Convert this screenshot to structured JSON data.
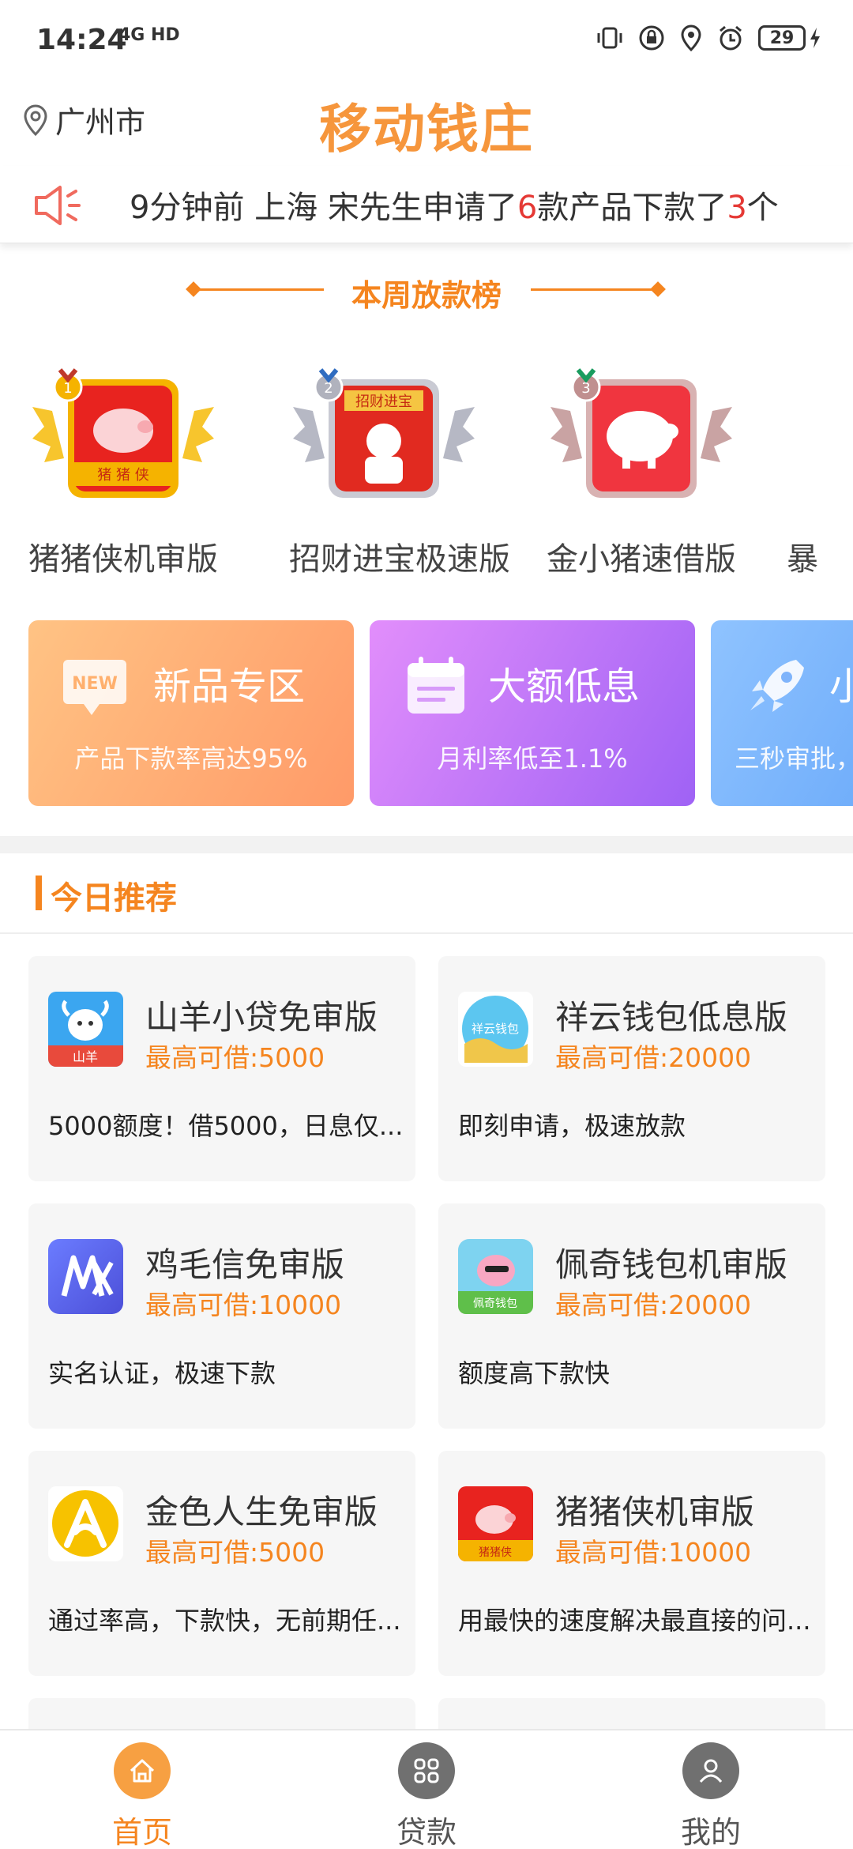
{
  "status": {
    "time": "14:24",
    "network": "4G HD",
    "battery": "29"
  },
  "header": {
    "location": "广州市",
    "title": "移动钱庄"
  },
  "notice": {
    "prefix": "9分钟前 上海 宋先生申请了",
    "apply_count": "6",
    "middle": "款产品下款了",
    "loan_count": "3",
    "suffix": "个"
  },
  "ranking": {
    "title": "本周放款榜",
    "items": [
      {
        "name": "猪猪侠机审版",
        "logo_text": "猪 猪 侠",
        "medal": "1"
      },
      {
        "name": "招财进宝极速版",
        "logo_text": "招财进宝",
        "medal": "2"
      },
      {
        "name": "金小猪速借版",
        "logo_text": "",
        "medal": "3"
      },
      {
        "name": "暴",
        "logo_text": "",
        "medal": ""
      }
    ]
  },
  "promos": [
    {
      "title": "新品专区",
      "subtitle": "产品下款率高达95%",
      "icon": "new-badge-icon",
      "badge": "NEW"
    },
    {
      "title": "大额低息",
      "subtitle": "月利率低至1.1%",
      "icon": "calendar-icon"
    },
    {
      "title": "小",
      "subtitle": "三秒审批，",
      "icon": "rocket-icon"
    }
  ],
  "today": {
    "title": "今日推荐",
    "cards": [
      {
        "name": "山羊小贷免审版",
        "amount": "最高可借:5000",
        "desc": "5000额度！借5000，日息仅...",
        "logo": "goat-logo",
        "logo_text": "山羊"
      },
      {
        "name": "祥云钱包低息版",
        "amount": "最高可借:20000",
        "desc": "即刻申请，极速放款",
        "logo": "cloud-logo",
        "logo_text": "祥云钱包"
      },
      {
        "name": "鸡毛信免审版",
        "amount": "最高可借:10000",
        "desc": "实名认证，极速下款",
        "logo": "jmx-logo",
        "logo_text": "JMX"
      },
      {
        "name": "佩奇钱包机审版",
        "amount": "最高可借:20000",
        "desc": "额度高下款快",
        "logo": "peppa-logo",
        "logo_text": "佩奇钱包"
      },
      {
        "name": "金色人生免审版",
        "amount": "最高可借:5000",
        "desc": "通过率高，下款快，无前期任...",
        "logo": "golden-logo",
        "logo_text": ""
      },
      {
        "name": "猪猪侠机审版",
        "amount": "最高可借:10000",
        "desc": "用最快的速度解决最直接的问...",
        "logo": "pig-logo",
        "logo_text": "猪猪侠"
      }
    ]
  },
  "nav": {
    "items": [
      {
        "label": "首页",
        "icon": "home-icon",
        "active": true
      },
      {
        "label": "贷款",
        "icon": "grid-icon",
        "active": false
      },
      {
        "label": "我的",
        "icon": "user-icon",
        "active": false
      }
    ]
  },
  "colors": {
    "accent": "#f5851f",
    "title": "#f6963c",
    "highlight": "#e53935"
  }
}
